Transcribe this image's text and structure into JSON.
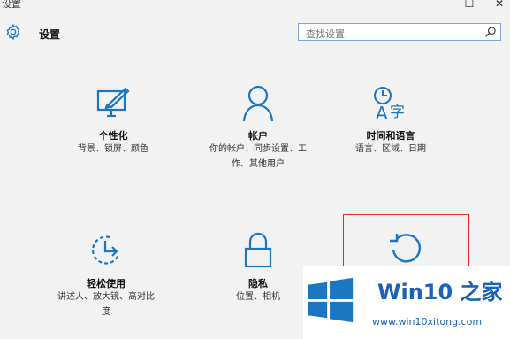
{
  "window": {
    "title": "设置",
    "minimize": "—",
    "maximize": "☐",
    "close": "✕"
  },
  "header": {
    "app_title": "设置"
  },
  "search": {
    "placeholder": "查找设置"
  },
  "tiles": [
    {
      "name": "个性化",
      "desc": "背景、锁屏、颜色"
    },
    {
      "name": "帐户",
      "desc": "你的帐户、同步设置、工作、其他用户"
    },
    {
      "name": "时间和语言",
      "desc": "语言、区域、日期"
    },
    {
      "name": "轻松使用",
      "desc": "讲述人、放大镜、高对比度"
    },
    {
      "name": "隐私",
      "desc": "位置、相机"
    }
  ],
  "watermark": {
    "brand": "Win10 之家",
    "url": "www.win10xitong.com"
  },
  "colors": {
    "accent": "#1c77c3",
    "highlight": "#e0302b",
    "brand": "#1c63b7"
  }
}
